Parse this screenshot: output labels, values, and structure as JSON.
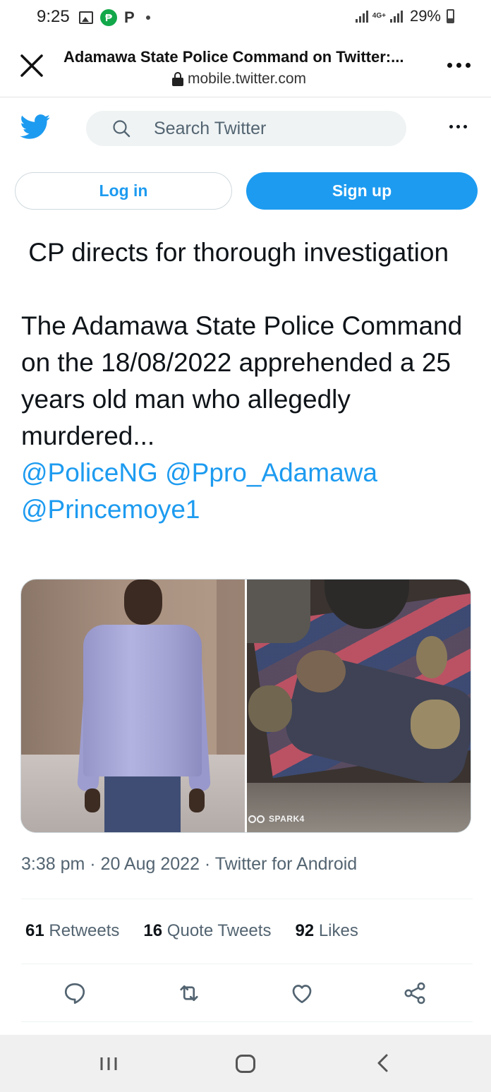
{
  "status_bar": {
    "time": "9:25",
    "pay_glyph": "₱",
    "p_glyph": "P",
    "network": "4G+",
    "battery": "29%"
  },
  "browser": {
    "title": "Adamawa State Police Command on Twitter:...",
    "url": "mobile.twitter.com"
  },
  "twitter": {
    "search_placeholder": "Search Twitter",
    "login_label": "Log in",
    "signup_label": "Sign up"
  },
  "tweet": {
    "headline": " CP directs for thorough investigation",
    "body": "The Adamawa State Police Command on the 18/08/2022 apprehended a 25 years old man who allegedly murdered...",
    "mentions": [
      "@PoliceNG",
      "@Ppro_Adamawa",
      "@Princemoye1"
    ],
    "media_watermark": "SPARK4",
    "meta": "3:38 pm · 20 Aug 2022 · Twitter for Android",
    "stats": {
      "retweets_count": "61",
      "retweets_label": "Retweets",
      "quotes_count": "16",
      "quotes_label": "Quote Tweets",
      "likes_count": "92",
      "likes_label": "Likes"
    }
  },
  "colors": {
    "accent": "#1d9bf0",
    "text": "#0f1419",
    "secondary": "#536471"
  },
  "icons": [
    "close-icon",
    "lock-icon",
    "more-icon",
    "twitter-logo-icon",
    "search-icon",
    "reply-icon",
    "retweet-icon",
    "like-icon",
    "share-icon",
    "nav-recents-icon",
    "nav-home-icon",
    "nav-back-icon"
  ]
}
